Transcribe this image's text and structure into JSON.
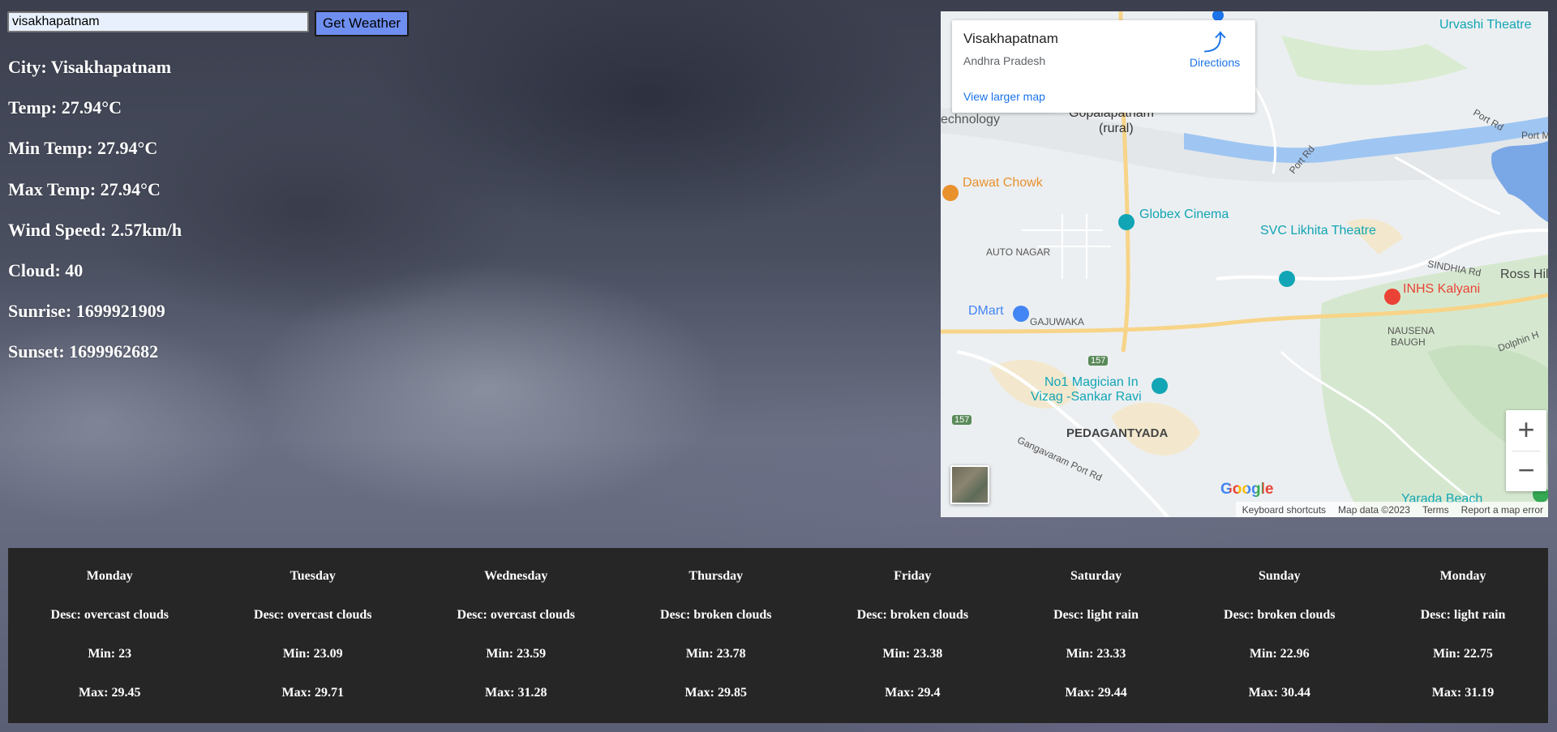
{
  "search": {
    "value": "visakhapatnam",
    "button_label": "Get Weather"
  },
  "weather": {
    "city": "City: Visakhapatnam",
    "temp": "Temp: 27.94°C",
    "min_temp": "Min Temp: 27.94°C",
    "max_temp": "Max Temp: 27.94°C",
    "wind": "Wind Speed: 2.57km/h",
    "cloud": "Cloud: 40",
    "sunrise": "Sunrise: 1699921909",
    "sunset": "Sunset: 1699962682"
  },
  "map": {
    "place": "Visakhapatnam",
    "region": "Andhra Pradesh",
    "directions_label": "Directions",
    "larger_map_label": "View larger map",
    "zoom_in": "+",
    "zoom_out": "−",
    "google_logo": "Google",
    "footer": {
      "shortcuts": "Keyboard shortcuts",
      "data": "Map data ©2023",
      "terms": "Terms",
      "report": "Report a map error"
    },
    "labels": {
      "urvashi": "Urvashi Theatre",
      "gopalapatnam": "Gopalapatnam",
      "rural": "(rural)",
      "technology": "echnology",
      "dawat": "Dawat Chowk",
      "globex": "Globex Cinema",
      "svc": "SVC Likhita Theatre",
      "autonagar": "AUTO NAGAR",
      "inhs": "INHS Kalyani",
      "dmart": "DMart",
      "gajuwaka": "GAJUWAKA",
      "nausena": "NAUSENA",
      "baugh": "BAUGH",
      "magician1": "No1 Magician In",
      "magician2": "Vizag -Sankar Ravi",
      "pedagantyada": "PEDAGANTYADA",
      "portrd": "Port Rd",
      "portrd2": "Port Rd",
      "portrd3": "Port M",
      "sindhia": "SINDHIA Rd",
      "rosshill": "Ross Hill",
      "dolphin": "Dolphin H",
      "gangavaram": "Gangavaram Port Rd",
      "yarada": "Yarada Beach",
      "route157a": "157",
      "route157b": "157"
    }
  },
  "forecast": [
    {
      "day": "Monday",
      "desc": "Desc: overcast clouds",
      "min": "Min: 23",
      "max": "Max: 29.45"
    },
    {
      "day": "Tuesday",
      "desc": "Desc: overcast clouds",
      "min": "Min: 23.09",
      "max": "Max: 29.71"
    },
    {
      "day": "Wednesday",
      "desc": "Desc: overcast clouds",
      "min": "Min: 23.59",
      "max": "Max: 31.28"
    },
    {
      "day": "Thursday",
      "desc": "Desc: broken clouds",
      "min": "Min: 23.78",
      "max": "Max: 29.85"
    },
    {
      "day": "Friday",
      "desc": "Desc: broken clouds",
      "min": "Min: 23.38",
      "max": "Max: 29.4"
    },
    {
      "day": "Saturday",
      "desc": "Desc: light rain",
      "min": "Min: 23.33",
      "max": "Max: 29.44"
    },
    {
      "day": "Sunday",
      "desc": "Desc: broken clouds",
      "min": "Min: 22.96",
      "max": "Max: 30.44"
    },
    {
      "day": "Monday",
      "desc": "Desc: light rain",
      "min": "Min: 22.75",
      "max": "Max: 31.19"
    }
  ],
  "colors": {
    "button": "#6f8ff0",
    "forecast_bg": "#262626",
    "link": "#1a73e8"
  }
}
